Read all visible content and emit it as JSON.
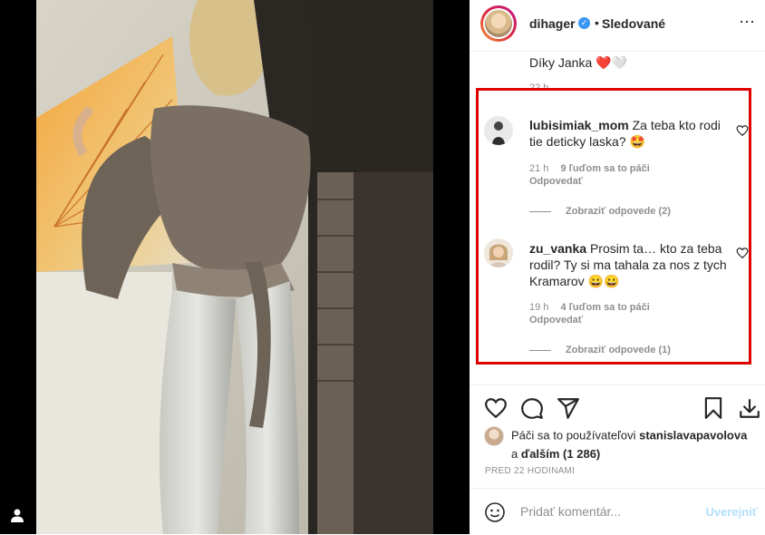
{
  "header": {
    "username": "dihager",
    "separator": "•",
    "follow_status": "Sledované",
    "more_icon": "more-horizontal-icon"
  },
  "comments_panel": {
    "top_comment_text": "Díky Janka ❤️🤍",
    "top_comment_time": "22 h",
    "items": [
      {
        "username": "lubisimiak_mom",
        "text": "Za teba kto rodi tie deticky laska? 🤩",
        "time": "21 h",
        "likes": "9 ľuďom sa to páči",
        "reply": "Odpovedať",
        "view_replies": "Zobraziť odpovede (2)"
      },
      {
        "username": "zu_vanka",
        "text": "Prosim ta… kto za teba rodil? Ty si ma tahala za nos z tych Kramarov 😀😀",
        "time": "19 h",
        "likes": "4 ľuďom sa to páči",
        "reply": "Odpovedať",
        "view_replies": "Zobraziť odpovede (1)"
      }
    ]
  },
  "actions": {
    "like_icon": "heart-icon",
    "comment_icon": "comment-icon",
    "share_icon": "paper-plane-icon",
    "save_icon": "bookmark-icon",
    "download_icon": "download-icon"
  },
  "likes": {
    "prefix": "Páči sa to používateľovi",
    "user": "stanislavapavolova",
    "and": "a",
    "others": "ďalším (1 286)"
  },
  "posted_time": "PRED 22 HODINAMI",
  "add_comment": {
    "placeholder": "Pridať komentár...",
    "post_label": "Uverejniť"
  },
  "colors": {
    "highlight": "#e00000",
    "verified": "#3897f0",
    "muted": "#8e8e8e"
  }
}
